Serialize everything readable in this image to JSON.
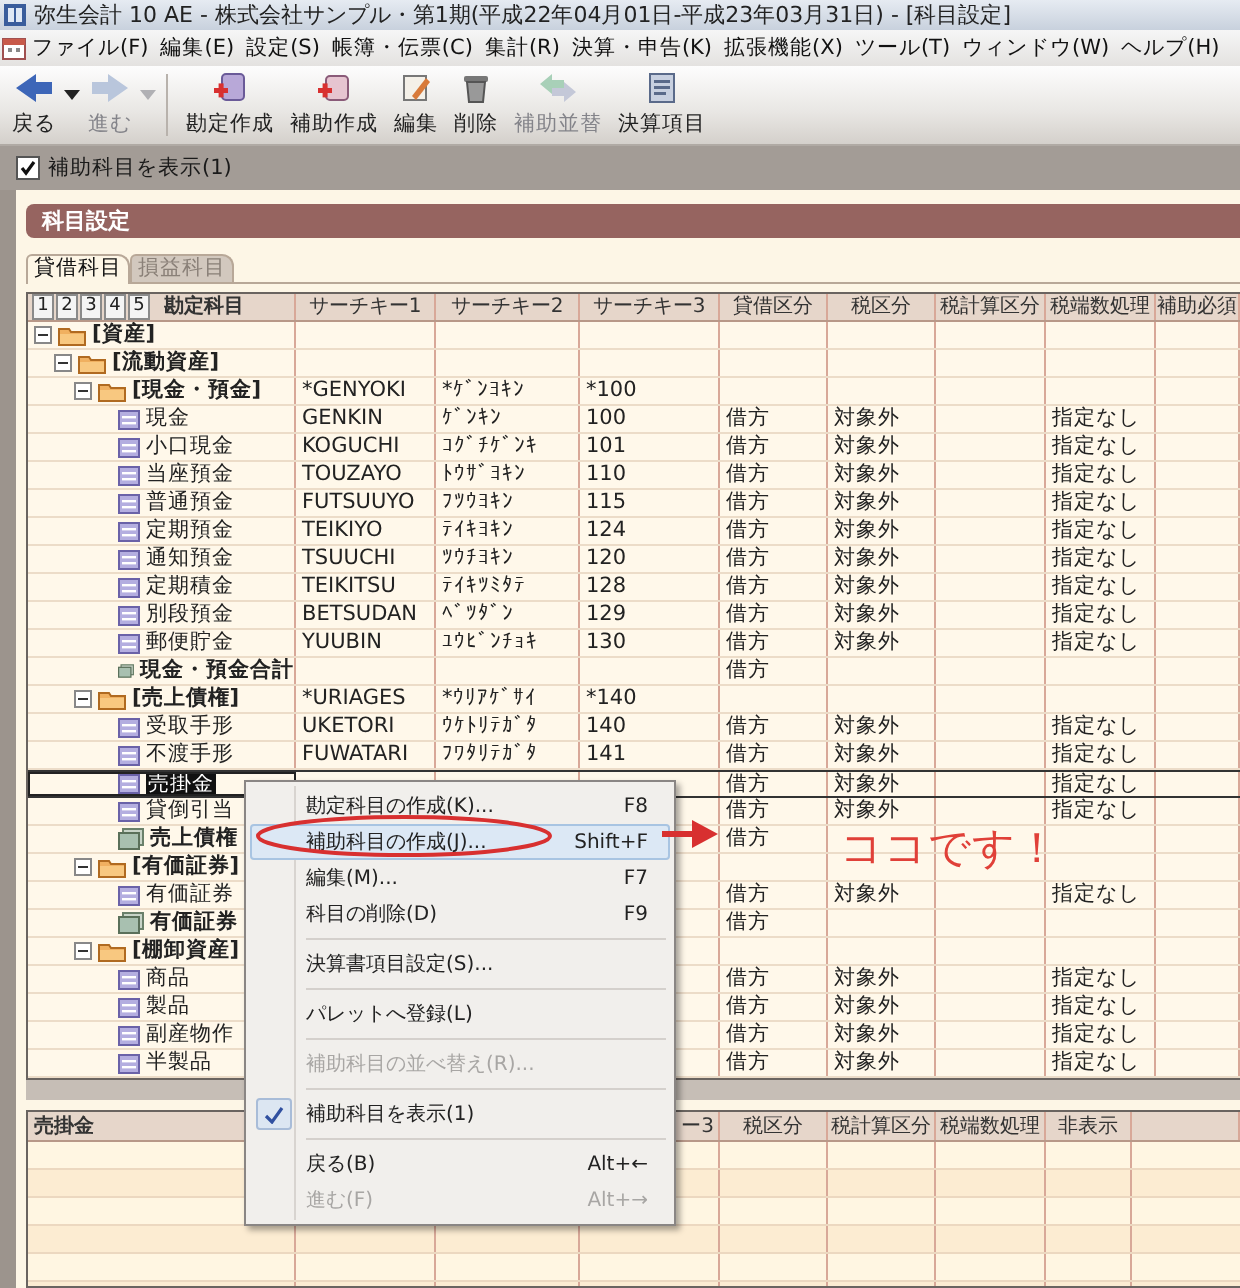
{
  "window": {
    "title": "弥生会計 10 AE - 株式会社サンプル・第1期(平成22年04月01日-平成23年03月31日) - [科目設定]"
  },
  "menu": [
    "ファイル(F)",
    "編集(E)",
    "設定(S)",
    "帳簿・伝票(C)",
    "集計(R)",
    "決算・申告(K)",
    "拡張機能(X)",
    "ツール(T)",
    "ウィンドウ(W)",
    "ヘルプ(H)"
  ],
  "toolbar": [
    {
      "kind": "back",
      "label": "戻る",
      "disabled": false,
      "dropdown": true
    },
    {
      "kind": "forward",
      "label": "進む",
      "disabled": true,
      "dropdown": true
    },
    {
      "kind": "new-account",
      "label": "勘定作成",
      "disabled": false,
      "dropdown": false
    },
    {
      "kind": "new-sub-account",
      "label": "補助作成",
      "disabled": false,
      "dropdown": false
    },
    {
      "kind": "edit",
      "label": "編集",
      "disabled": false,
      "dropdown": false
    },
    {
      "kind": "delete",
      "label": "削除",
      "disabled": false,
      "dropdown": false
    },
    {
      "kind": "sort",
      "label": "補助並替",
      "disabled": true,
      "dropdown": false
    },
    {
      "kind": "statement",
      "label": "決算項目",
      "disabled": false,
      "dropdown": false
    }
  ],
  "show_sub_accounts": {
    "label": "補助科目を表示(1)",
    "checked": true
  },
  "panel": {
    "title": "科目設定"
  },
  "tabs": [
    {
      "label": "貸借科目",
      "selected": true
    },
    {
      "label": "損益科目",
      "selected": false
    }
  ],
  "grid": {
    "level_buttons": [
      "1",
      "2",
      "3",
      "4",
      "5"
    ],
    "columns": [
      "勘定科目",
      "サーチキー1",
      "サーチキー2",
      "サーチキー3",
      "貸借区分",
      "税区分",
      "税計算区分",
      "税端数処理",
      "補助必須"
    ],
    "rows": [
      {
        "kind": "folder",
        "label": "[資産]",
        "expanded": true,
        "selected": false,
        "children": [
          {
            "kind": "folder",
            "label": "[流動資産]",
            "expanded": true,
            "selected": false,
            "children": [
              {
                "kind": "folder",
                "label": "[現金・預金]",
                "expanded": true,
                "selected": false,
                "search_key_1": "*GENYOKI",
                "search_key_2": "*ｹﾞﾝﾖｷﾝ",
                "search_key_3": "*100",
                "children": [
                  {
                    "kind": "account",
                    "label": "現金",
                    "selected": false,
                    "search_key_1": "GENKIN",
                    "search_key_2": "ｹﾞﾝｷﾝ",
                    "search_key_3": "100",
                    "balance_side": "借方",
                    "tax_class": "対象外",
                    "tax_rounding": "指定なし"
                  },
                  {
                    "kind": "account",
                    "label": "小口現金",
                    "selected": false,
                    "search_key_1": "KOGUCHI",
                    "search_key_2": "ｺｸﾞﾁｹﾞﾝｷ",
                    "search_key_3": "101",
                    "balance_side": "借方",
                    "tax_class": "対象外",
                    "tax_rounding": "指定なし"
                  },
                  {
                    "kind": "account",
                    "label": "当座預金",
                    "selected": false,
                    "search_key_1": "TOUZAYO",
                    "search_key_2": "ﾄｳｻﾞﾖｷﾝ",
                    "search_key_3": "110",
                    "balance_side": "借方",
                    "tax_class": "対象外",
                    "tax_rounding": "指定なし"
                  },
                  {
                    "kind": "account",
                    "label": "普通預金",
                    "selected": false,
                    "search_key_1": "FUTSUUYO",
                    "search_key_2": "ﾌﾂｳﾖｷﾝ",
                    "search_key_3": "115",
                    "balance_side": "借方",
                    "tax_class": "対象外",
                    "tax_rounding": "指定なし"
                  },
                  {
                    "kind": "account",
                    "label": "定期預金",
                    "selected": false,
                    "search_key_1": "TEIKIYO",
                    "search_key_2": "ﾃｲｷﾖｷﾝ",
                    "search_key_3": "124",
                    "balance_side": "借方",
                    "tax_class": "対象外",
                    "tax_rounding": "指定なし"
                  },
                  {
                    "kind": "account",
                    "label": "通知預金",
                    "selected": false,
                    "search_key_1": "TSUUCHI",
                    "search_key_2": "ﾂｳﾁﾖｷﾝ",
                    "search_key_3": "120",
                    "balance_side": "借方",
                    "tax_class": "対象外",
                    "tax_rounding": "指定なし"
                  },
                  {
                    "kind": "account",
                    "label": "定期積金",
                    "selected": false,
                    "search_key_1": "TEIKITSU",
                    "search_key_2": "ﾃｲｷﾂﾐﾀﾃ",
                    "search_key_3": "128",
                    "balance_side": "借方",
                    "tax_class": "対象外",
                    "tax_rounding": "指定なし"
                  },
                  {
                    "kind": "account",
                    "label": "別段預金",
                    "selected": false,
                    "search_key_1": "BETSUDAN",
                    "search_key_2": "ﾍﾞﾂﾀﾞﾝ",
                    "search_key_3": "129",
                    "balance_side": "借方",
                    "tax_class": "対象外",
                    "tax_rounding": "指定なし"
                  },
                  {
                    "kind": "account",
                    "label": "郵便貯金",
                    "selected": false,
                    "search_key_1": "YUUBIN",
                    "search_key_2": "ﾕｳﾋﾞﾝﾁｮｷ",
                    "search_key_3": "130",
                    "balance_side": "借方",
                    "tax_class": "対象外",
                    "tax_rounding": "指定なし"
                  },
                  {
                    "kind": "total",
                    "label": "現金・預金合計",
                    "selected": false,
                    "balance_side": "借方"
                  }
                ]
              },
              {
                "kind": "folder",
                "label": "[売上債権]",
                "expanded": true,
                "selected": false,
                "search_key_1": "*URIAGES",
                "search_key_2": "*ｳﾘｱｹﾞｻｲ",
                "search_key_3": "*140",
                "children": [
                  {
                    "kind": "account",
                    "label": "受取手形",
                    "selected": false,
                    "search_key_1": "UKETORI",
                    "search_key_2": "ｳｹﾄﾘﾃｶﾞﾀ",
                    "search_key_3": "140",
                    "balance_side": "借方",
                    "tax_class": "対象外",
                    "tax_rounding": "指定なし"
                  },
                  {
                    "kind": "account",
                    "label": "不渡手形",
                    "selected": false,
                    "search_key_1": "FUWATARI",
                    "search_key_2": "ﾌﾜﾀﾘﾃｶﾞﾀ",
                    "search_key_3": "141",
                    "balance_side": "借方",
                    "tax_class": "対象外",
                    "tax_rounding": "指定なし"
                  },
                  {
                    "kind": "account",
                    "label": "売掛金",
                    "selected": true,
                    "balance_side": "借方",
                    "tax_class": "対象外",
                    "tax_rounding": "指定なし"
                  },
                  {
                    "kind": "account",
                    "label": "貸倒引当",
                    "selected": false,
                    "balance_side": "借方",
                    "tax_class": "対象外",
                    "tax_rounding": "指定なし"
                  },
                  {
                    "kind": "total",
                    "label": "売上債権",
                    "selected": false,
                    "balance_side": "借方"
                  }
                ]
              },
              {
                "kind": "folder",
                "label": "[有価証券]",
                "expanded": true,
                "selected": false,
                "children": [
                  {
                    "kind": "account",
                    "label": "有価証券",
                    "selected": false,
                    "balance_side": "借方",
                    "tax_class": "対象外",
                    "tax_rounding": "指定なし"
                  },
                  {
                    "kind": "total",
                    "label": "有価証券",
                    "selected": false,
                    "balance_side": "借方"
                  }
                ]
              },
              {
                "kind": "folder",
                "label": "[棚卸資産]",
                "expanded": true,
                "selected": false,
                "children": [
                  {
                    "kind": "account",
                    "label": "商品",
                    "selected": false,
                    "balance_side": "借方",
                    "tax_class": "対象外",
                    "tax_rounding": "指定なし"
                  },
                  {
                    "kind": "account",
                    "label": "製品",
                    "selected": false,
                    "balance_side": "借方",
                    "tax_class": "対象外",
                    "tax_rounding": "指定なし"
                  },
                  {
                    "kind": "account",
                    "label": "副産物作",
                    "selected": false,
                    "balance_side": "借方",
                    "tax_class": "対象外",
                    "tax_rounding": "指定なし"
                  },
                  {
                    "kind": "account",
                    "label": "半製品",
                    "selected": false,
                    "balance_side": "借方",
                    "tax_class": "対象外",
                    "tax_rounding": "指定なし"
                  }
                ]
              }
            ]
          }
        ]
      }
    ]
  },
  "detail_grid": {
    "title": "売掛金",
    "columns": [
      "ー3",
      "税区分",
      "税計算区分",
      "税端数処理",
      "非表示"
    ]
  },
  "context_menu": {
    "items": [
      {
        "kind": "item",
        "label": "勘定科目の作成(K)...",
        "shortcut": "F8",
        "selected": false,
        "disabled": false,
        "checked": false
      },
      {
        "kind": "item",
        "label": "補助科目の作成(J)...",
        "shortcut": "Shift+F",
        "selected": true,
        "disabled": false,
        "checked": false
      },
      {
        "kind": "item",
        "label": "編集(M)...",
        "shortcut": "F7",
        "selected": false,
        "disabled": false,
        "checked": false
      },
      {
        "kind": "item",
        "label": "科目の削除(D)",
        "shortcut": "F9",
        "selected": false,
        "disabled": false,
        "checked": false
      },
      {
        "kind": "separator"
      },
      {
        "kind": "item",
        "label": "決算書項目設定(S)...",
        "selected": false,
        "disabled": false,
        "checked": false
      },
      {
        "kind": "separator"
      },
      {
        "kind": "item",
        "label": "パレットへ登録(L)",
        "selected": false,
        "disabled": false,
        "checked": false
      },
      {
        "kind": "separator"
      },
      {
        "kind": "item",
        "label": "補助科目の並べ替え(R)...",
        "selected": false,
        "disabled": true,
        "checked": false
      },
      {
        "kind": "separator"
      },
      {
        "kind": "item",
        "label": "補助科目を表示(1)",
        "selected": false,
        "disabled": false,
        "checked": true
      },
      {
        "kind": "separator"
      },
      {
        "kind": "item",
        "label": "戻る(B)",
        "shortcut": "Alt+←",
        "selected": false,
        "disabled": false,
        "checked": false
      },
      {
        "kind": "item",
        "label": "進む(F)",
        "shortcut": "Alt+→",
        "selected": false,
        "disabled": true,
        "checked": false
      }
    ]
  },
  "annotation": {
    "text": "ココです！"
  }
}
